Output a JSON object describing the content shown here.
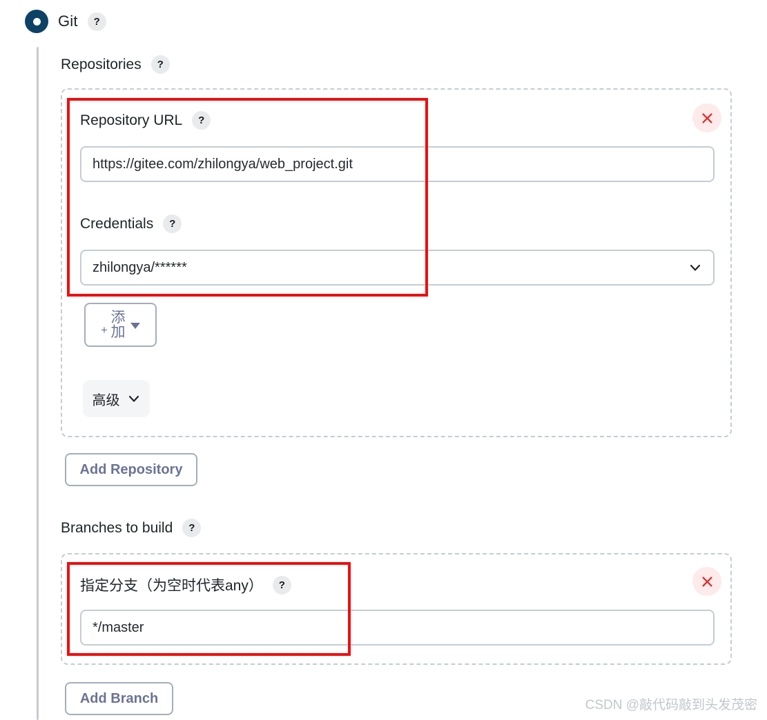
{
  "scm": {
    "radio_label": "Git",
    "radio_selected": true,
    "help_glyph": "?"
  },
  "repositories": {
    "heading": "Repositories",
    "repo_url": {
      "label": "Repository URL",
      "value": "https://gitee.com/zhilongya/web_project.git",
      "placeholder": ""
    },
    "credentials": {
      "label": "Credentials",
      "selected": "zhilongya/******"
    },
    "add_credentials_button": {
      "plus": "+",
      "label": "添\n加"
    },
    "advanced_button": {
      "label": "高级"
    },
    "add_repository_button": {
      "label": "Add Repository"
    },
    "remove_button_glyph": "×"
  },
  "branches": {
    "heading": "Branches to build",
    "branch_spec": {
      "label": "指定分支（为空时代表any）",
      "value": "*/master",
      "placeholder": ""
    },
    "add_branch_button": {
      "label": "Add Branch"
    },
    "remove_button_glyph": "×"
  },
  "watermark": {
    "text": "CSDN @敲代码敲到头发茂密"
  },
  "colors": {
    "radio_fill": "#0d4166",
    "annotation_red": "#f20d0d",
    "remove_bg": "#fdeaea",
    "remove_fg": "#e02b2b",
    "border_gray": "#c3ccd4",
    "button_text": "#6b7394"
  }
}
